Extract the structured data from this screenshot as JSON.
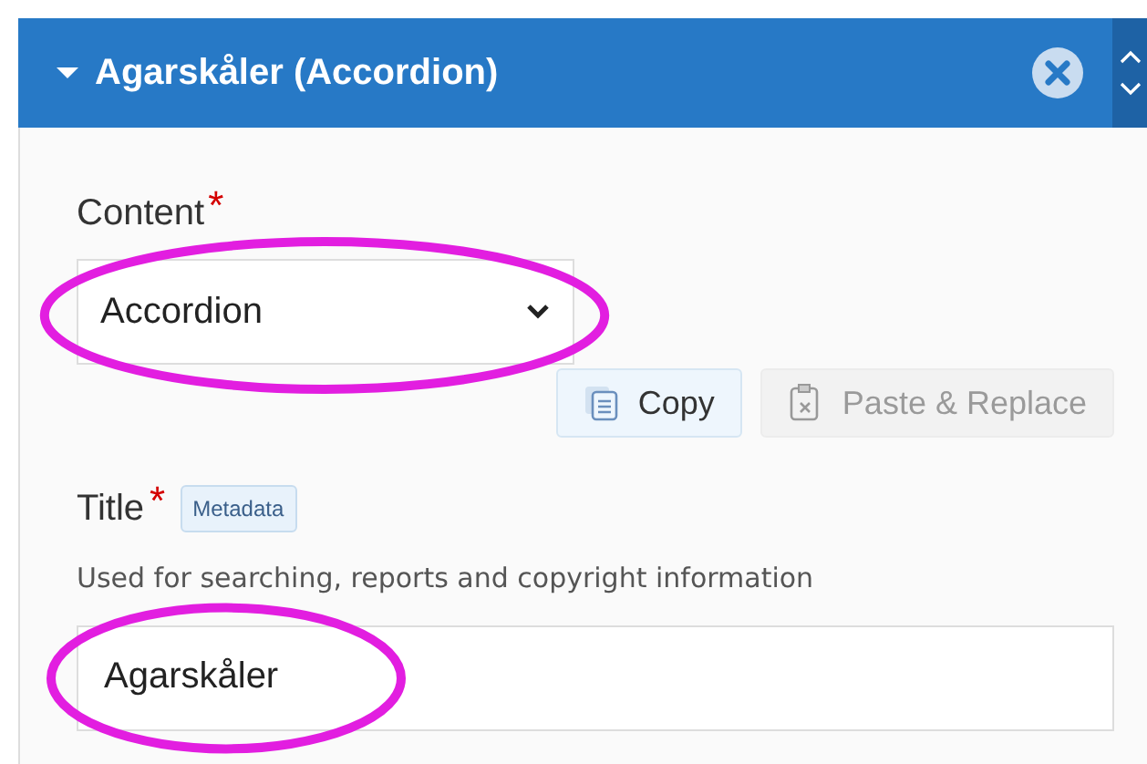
{
  "header": {
    "title": "Agarskåler (Accordion)",
    "expanded": true
  },
  "content": {
    "label": "Content",
    "required_mark": "*",
    "value": "Accordion",
    "circled": true
  },
  "buttons": [
    {
      "label": "Copy",
      "disabled": false
    },
    {
      "label": "Paste & Replace",
      "disabled": true
    }
  ],
  "title_field": {
    "label": "Title",
    "required_mark": "*",
    "tag": "Metadata",
    "help": "Used for searching, reports and copyright information",
    "value": "Agarskåler",
    "circled": true
  }
}
